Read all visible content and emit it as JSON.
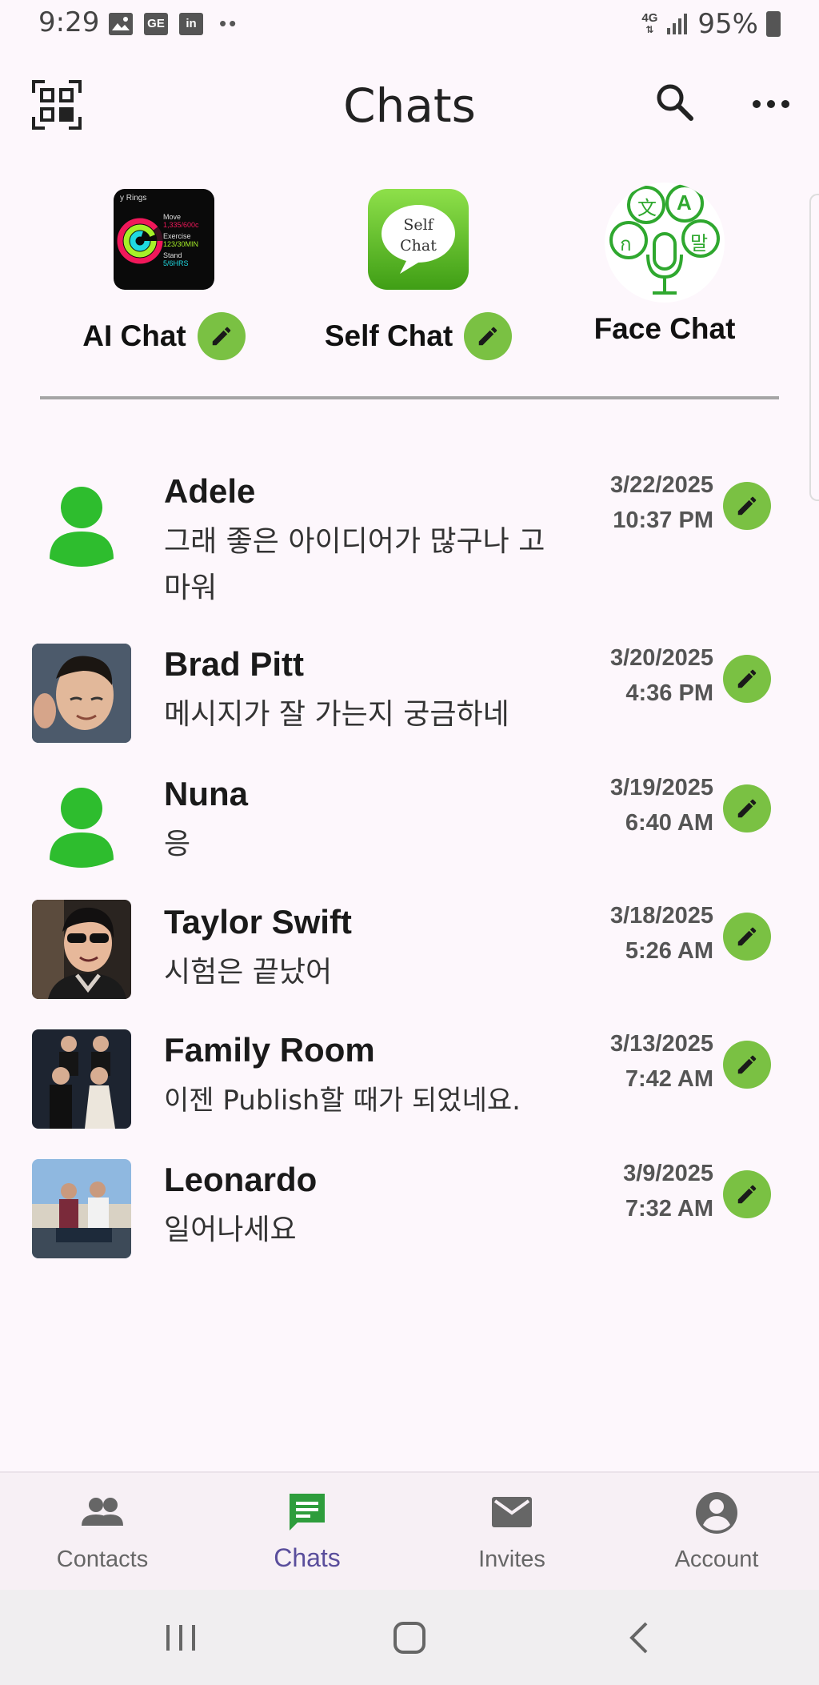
{
  "status_bar": {
    "time": "9:29",
    "icons": [
      "image-icon",
      "gmail-icon",
      "linkedin-icon"
    ],
    "icon_labels": [
      "",
      "GE",
      "in"
    ],
    "dots": "••",
    "network": "4G",
    "battery": "95%"
  },
  "header": {
    "title": "Chats"
  },
  "quick_actions": [
    {
      "label": "AI Chat",
      "icon": "activity-rings-icon",
      "editable": true
    },
    {
      "label": "Self Chat",
      "icon": "self-chat-bubble-icon",
      "editable": true,
      "image_text": "Self\nChat"
    },
    {
      "label": "Face Chat",
      "icon": "translation-microphone-icon",
      "editable": false
    }
  ],
  "ai_chat_image": {
    "heading": "y Rings",
    "move_label": "Move",
    "move_value": "1,335/600c",
    "exercise_label": "Exercise",
    "exercise_value": "123/30MIN",
    "stand_label": "Stand",
    "stand_value": "5/6HRS"
  },
  "face_chat_image": {
    "glyphs": [
      "文",
      "A",
      "ก",
      "말"
    ]
  },
  "chats": [
    {
      "name": "Adele",
      "message": "그래 좋은 아이디어가 많구나 고마워",
      "date": "3/22/2025",
      "time": "10:37 PM",
      "avatar": "default-person-icon"
    },
    {
      "name": "Brad Pitt",
      "message": "메시지가 잘 가는지 궁금하네",
      "date": "3/20/2025",
      "time": "4:36 PM",
      "avatar": "photo"
    },
    {
      "name": "Nuna",
      "message": "응",
      "date": "3/19/2025",
      "time": "6:40 AM",
      "avatar": "default-person-icon"
    },
    {
      "name": "Taylor Swift",
      "message": "시험은 끝났어",
      "date": "3/18/2025",
      "time": "5:26 AM",
      "avatar": "photo"
    },
    {
      "name": "Family Room",
      "message": "이젠 Publish할 때가 되었네요.",
      "date": "3/13/2025",
      "time": "7:42 AM",
      "avatar": "photo"
    },
    {
      "name": "Leonardo",
      "message": "일어나세요",
      "date": "3/9/2025",
      "time": "7:32 AM",
      "avatar": "photo"
    }
  ],
  "bottom_nav": [
    {
      "label": "Contacts",
      "icon": "contacts-icon",
      "active": false
    },
    {
      "label": "Chats",
      "icon": "chat-icon",
      "active": true
    },
    {
      "label": "Invites",
      "icon": "mail-icon",
      "active": false
    },
    {
      "label": "Account",
      "icon": "account-icon",
      "active": false
    }
  ],
  "colors": {
    "background": "#fdf7fc",
    "edit_green": "#7ac143",
    "avatar_green": "#2ebd2e",
    "active_nav": "#5a4e9c"
  }
}
